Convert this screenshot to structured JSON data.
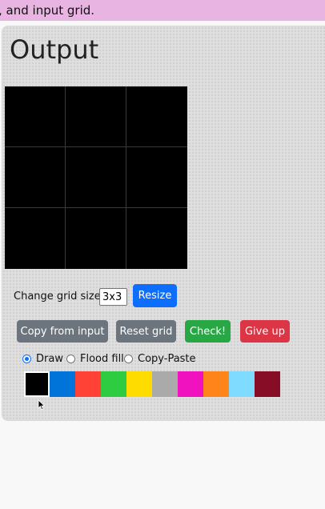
{
  "banner": {
    "text": ", and input grid."
  },
  "output": {
    "title": "Output",
    "grid": {
      "rows": 3,
      "cols": 3,
      "cell_color": "#000000"
    }
  },
  "resize": {
    "label": "Change grid size:",
    "value": "3x3",
    "button": "Resize"
  },
  "actions": {
    "copy": "Copy from input",
    "reset": "Reset grid",
    "check": "Check!",
    "give_up": "Give up"
  },
  "tools": {
    "selected": "Draw",
    "options": [
      "Draw",
      "Flood fill",
      "Copy-Paste"
    ]
  },
  "palette": {
    "selected_index": 0,
    "colors": [
      "#000000",
      "#0074D9",
      "#FF4136",
      "#2ECC40",
      "#FFDC00",
      "#AAAAAA",
      "#F012BE",
      "#FF851B",
      "#7FDBFF",
      "#870C25"
    ]
  },
  "colors": {
    "primary": "#0d6efd",
    "secondary": "#6c757d",
    "success": "#28a745",
    "danger": "#dc3545",
    "banner": "#e8b4e2"
  }
}
